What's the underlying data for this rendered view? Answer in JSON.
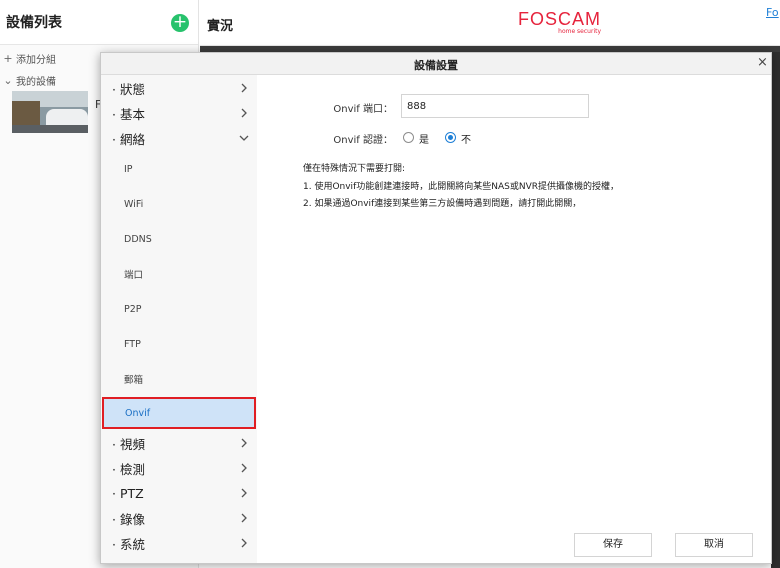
{
  "app": {
    "device_list_title": "設備列表",
    "add_group": "添加分組",
    "my_devices": "我的設備",
    "device_name_initial": "F",
    "live_title": "實況",
    "brand_name": "FOSCAM",
    "brand_sub": "home security",
    "top_link": "Fo"
  },
  "dialog": {
    "title": "設備設置",
    "close": "×",
    "nav": {
      "status": "· 狀態",
      "basic": "· 基本",
      "network": "· 網絡",
      "sub": [
        "IP",
        "WiFi",
        "DDNS",
        "端口",
        "P2P",
        "FTP",
        "郵箱",
        "Onvif"
      ],
      "video": "· 視頻",
      "detection": "· 檢測",
      "ptz": "· PTZ",
      "record": "· 錄像",
      "system": "· 系統"
    },
    "onvif": {
      "port_label": "Onvif 端口：",
      "port_value": "888",
      "auth_label": "Onvif 認證：",
      "auth_yes": "是",
      "auth_no": "不",
      "auth_selected": "no",
      "note_title": "僅在特殊情況下需要打開:",
      "note_1": "1. 使用Onvif功能創建連接時，此開關將向某些NAS或NVR提供攝像機的授權，",
      "note_2": "2. 如果通過Onvif連接到某些第三方設備時遇到問題，請打開此開關，"
    },
    "save_label": "保存",
    "cancel_label": "取消"
  },
  "colors": {
    "brand": "#e6233c",
    "accent": "#1e7fd6",
    "add_button": "#27c26c",
    "selection_outline": "#e01e24"
  }
}
